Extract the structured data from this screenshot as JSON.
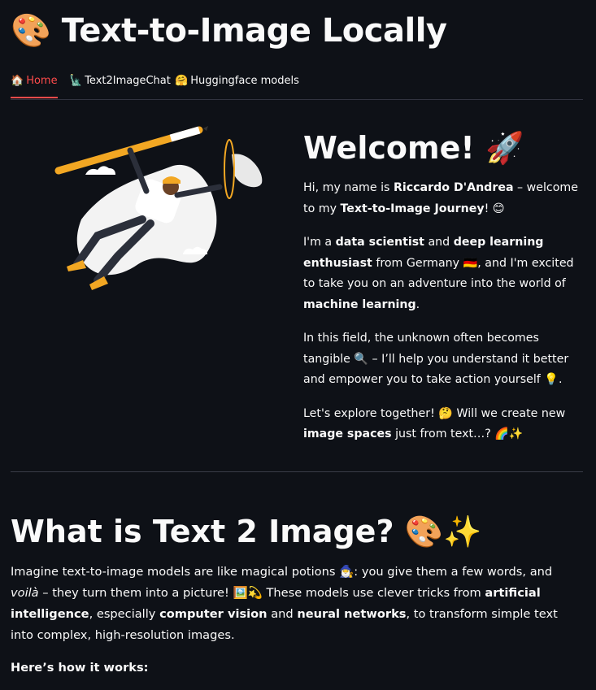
{
  "header": {
    "icon": "palette-icon",
    "emoji": "🎨",
    "title": "Text-to-Image Locally"
  },
  "tabs": [
    {
      "icon": "house-icon",
      "emoji": "🏠",
      "label": "Home",
      "active": true
    },
    {
      "icon": "statue-of-liberty-icon",
      "emoji": "🗽",
      "label": "Text2ImageChat",
      "active": false
    },
    {
      "icon": "hugging-face-icon",
      "emoji": "🤗",
      "label": "Huggingface models",
      "active": false
    }
  ],
  "accent_color": "#ff4b4b",
  "welcome": {
    "heading": "Welcome!",
    "heading_emoji": "🚀",
    "p1": {
      "a": "Hi, my name is ",
      "name": "Riccardo D'Andrea",
      "b": " – welcome to my ",
      "journey": "Text-to-Image Journey",
      "c": "! 😊"
    },
    "p2": {
      "a": "I'm a ",
      "ds": "data scientist",
      "b": " and ",
      "dle": "deep learning enthusiast",
      "c": " from Germany 🇩🇪, and I'm excited to take you on an adventure into the world of ",
      "ml": "machine learning",
      "d": "."
    },
    "p3": "In this field, the unknown often becomes tangible 🔍 – I’ll help you understand it better and empower you to take action yourself 💡.",
    "p4": {
      "a": "Let's explore together! 🤔 Will we create new ",
      "spaces": "image spaces",
      "b": " just from text…? 🌈✨"
    }
  },
  "what": {
    "heading": "What is Text 2 Image? 🎨✨",
    "p1": {
      "a": "Imagine text-to-image models are like magical potions 🧙‍♂️: you give them a few words, and ",
      "voila": "voilà",
      "b": " – they turn them into a picture! 🖼️💫 These models use clever tricks from ",
      "ai": "artificial intelligence",
      "c": ", especially ",
      "cv": "computer vision",
      "d": " and ",
      "nn": "neural networks",
      "e": ", to transform simple text into complex, high-resolution images."
    },
    "how": "Here’s how it works:"
  }
}
